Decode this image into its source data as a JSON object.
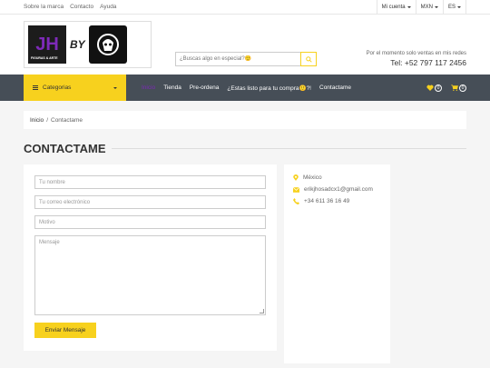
{
  "topbar": {
    "links": [
      "Sobre la marca",
      "Contacto",
      "Ayuda"
    ],
    "account": "Mi cuenta",
    "currency": "MXN",
    "language": "ES"
  },
  "header": {
    "logo_left": "JH",
    "logo_left_sub": "FIGURAS & ARTE",
    "logo_by": "BY",
    "search_placeholder": "¿Buscas algo en especial?🙂",
    "note": "Por el momento solo ventas en mis redes",
    "phone": "Tel: +52 797 117 2456"
  },
  "nav": {
    "categories_label": "Categorias",
    "links": [
      "Inicio",
      "Tienda",
      "Pre-ordena",
      "¿Estas listo para tu compra🙂?!",
      "Contactame"
    ],
    "active_index": 0,
    "wishlist_count": "0",
    "cart_count": "0"
  },
  "breadcrumb": {
    "home": "Inicio",
    "separator": "/",
    "current": "Contactame"
  },
  "page": {
    "title": "CONTACTAME"
  },
  "form": {
    "name_placeholder": "Tu nombre",
    "email_placeholder": "Tu correo electrónico",
    "subject_placeholder": "Motivo",
    "message_placeholder": "Mensaje",
    "submit_label": "Enviar Mensaje"
  },
  "info": {
    "location": "México",
    "email": "erikjhosadcx1@gmail.com",
    "phone": "+34 611 36 16 49"
  },
  "colors": {
    "accent": "#f7d11e",
    "nav_bg": "#464e57",
    "active_link": "#7d2ab8"
  }
}
